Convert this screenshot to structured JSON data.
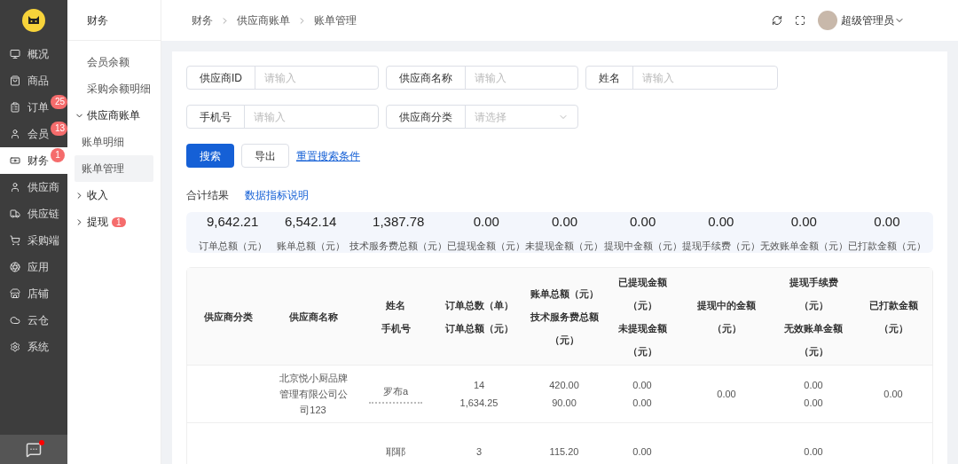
{
  "sidebar": {
    "items": [
      {
        "label": "概况",
        "selected": false
      },
      {
        "label": "商品",
        "selected": false
      },
      {
        "label": "订单",
        "badge": "25",
        "selected": false
      },
      {
        "label": "会员",
        "badge": "13",
        "selected": false
      },
      {
        "label": "财务",
        "badge": "1",
        "selected": true
      },
      {
        "label": "供应商",
        "selected": false
      },
      {
        "label": "供应链",
        "selected": false
      },
      {
        "label": "采购端",
        "selected": false
      },
      {
        "label": "应用",
        "selected": false
      },
      {
        "label": "店铺",
        "selected": false
      },
      {
        "label": "云仓",
        "selected": false
      },
      {
        "label": "系统",
        "selected": false
      }
    ],
    "chat_notification": true
  },
  "subnav": {
    "title": "财务",
    "items": [
      {
        "label": "会员余额",
        "selected": false
      },
      {
        "label": "采购余额明细",
        "selected": false
      },
      {
        "label": "供应商账单",
        "expanded": true,
        "children": [
          {
            "label": "账单明细",
            "selected": false
          },
          {
            "label": "账单管理",
            "selected": true
          }
        ]
      },
      {
        "label": "收入",
        "expanded": false
      },
      {
        "label": "提现",
        "expanded": false,
        "badge": "1"
      }
    ]
  },
  "breadcrumb": [
    "财务",
    "供应商账单",
    "账单管理"
  ],
  "user": {
    "name": "超级管理员"
  },
  "filters": [
    [
      {
        "label": "供应商ID",
        "placeholder": "请输入",
        "kind": "input"
      },
      {
        "label": "供应商名称",
        "placeholder": "请输入",
        "kind": "input"
      },
      {
        "label": "姓名",
        "placeholder": "请输入",
        "kind": "input"
      }
    ],
    [
      {
        "label": "手机号",
        "placeholder": "请输入",
        "kind": "input"
      },
      {
        "label": "供应商分类",
        "placeholder": "请选择",
        "kind": "select"
      }
    ]
  ],
  "actions": {
    "search": "搜索",
    "export": "导出",
    "reset": "重置搜索条件"
  },
  "summary": {
    "title": "合计结果",
    "help_link": "数据指标说明",
    "stats": [
      {
        "value": "9,642.21",
        "label": "订单总额（元）"
      },
      {
        "value": "6,542.14",
        "label": "账单总额（元）"
      },
      {
        "value": "1,387.78",
        "label": "技术服务费总额（元）"
      },
      {
        "value": "0.00",
        "label": "已提现金额（元）"
      },
      {
        "value": "0.00",
        "label": "未提现金额（元）"
      },
      {
        "value": "0.00",
        "label": "提现中金额（元）"
      },
      {
        "value": "0.00",
        "label": "提现手续费（元）"
      },
      {
        "value": "0.00",
        "label": "无效账单金额（元）"
      },
      {
        "value": "0.00",
        "label": "已打款金额（元）"
      }
    ]
  },
  "table": {
    "columns": [
      [
        "供应商分类"
      ],
      [
        "供应商名称"
      ],
      [
        "姓名",
        "手机号"
      ],
      [
        "订单总数（单）",
        "订单总额（元）"
      ],
      [
        "账单总额（元）",
        "技术服务费总额",
        "（元）"
      ],
      [
        "已提现金额",
        "（元）",
        "未提现金额",
        "（元）"
      ],
      [
        "提现中的金额",
        "（元）"
      ],
      [
        "提现手续费",
        "（元）",
        "无效账单金额",
        "（元）"
      ],
      [
        "已打款金额",
        "（元）"
      ]
    ],
    "rows": [
      {
        "supplier_name": "北京悦小厨品牌管理有限公司公司123",
        "contact_name": "罗布a",
        "phone_masked": true,
        "order_stats": [
          "14",
          "1,634.25"
        ],
        "bill_stats": [
          "420.00",
          "90.00"
        ],
        "withdrawn_stats": [
          "0.00",
          "0.00"
        ],
        "withdrawing": [
          "0.00"
        ],
        "fee_stats": [
          "0.00",
          "0.00"
        ],
        "paid": [
          "0.00"
        ]
      },
      {
        "contact_name": "耶耶",
        "order_stats": [
          "3"
        ],
        "bill_stats": [
          "115.20"
        ],
        "withdrawn_stats": [
          "0.00"
        ],
        "fee_stats": [
          "0.00"
        ]
      }
    ]
  }
}
